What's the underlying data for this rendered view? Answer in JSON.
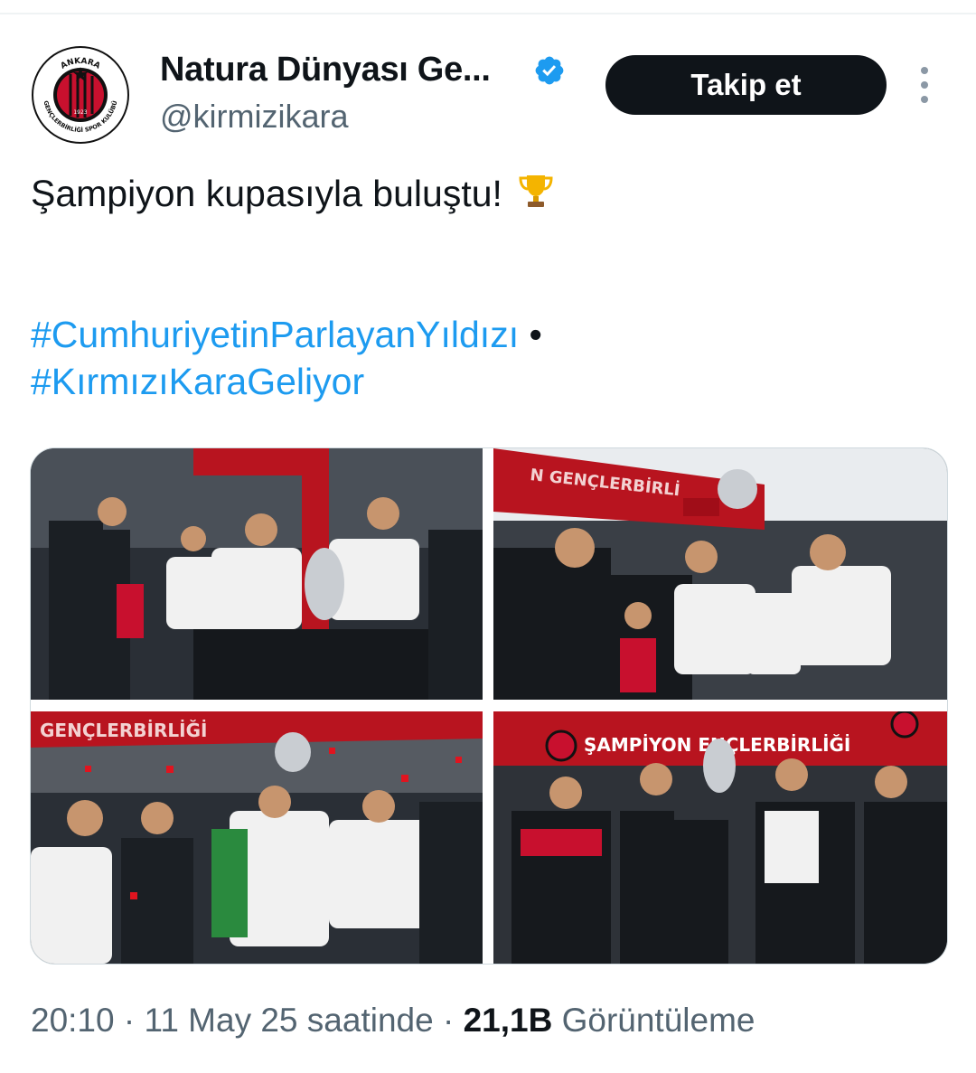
{
  "author": {
    "display_name": "Natura Dünyası Ge...",
    "handle": "@kirmizikara",
    "verified": true,
    "avatar_text": {
      "top": "ANKARA",
      "year": "1923",
      "ring": "GENÇLERBİRLİĞİ SPOR KULÜBÜ"
    }
  },
  "follow_button": {
    "label": "Takip et"
  },
  "tweet": {
    "line1": "Şampiyon kupasıyla buluştu!",
    "hashtag1": "#CumhuriyetinParlayanYıldızı",
    "bullet": "•",
    "hashtag2": "#KırmızıKaraGeliyor"
  },
  "photos": [
    {
      "banner": "",
      "icon": "celebration-photo"
    },
    {
      "banner": "N GENÇLERBİRLİ",
      "icon": "trophy-lift-photo"
    },
    {
      "banner": "GENÇLERBİRLİĞİ",
      "icon": "trophy-confetti-photo"
    },
    {
      "banner": "ŞAMPİYON  ENÇLERBİRLİĞİ",
      "icon": "trophy-podium-photo"
    }
  ],
  "meta": {
    "time": "20:10",
    "sep1": " · ",
    "date": "11 May 25 saatinde",
    "sep2": " · ",
    "views_count": "21,1B",
    "views_label": " Görüntüleme"
  },
  "colors": {
    "hashtag": "#1d9bf0",
    "verified": "#1d9bf0",
    "button_bg": "#0f1419",
    "club_red": "#c8102e"
  }
}
